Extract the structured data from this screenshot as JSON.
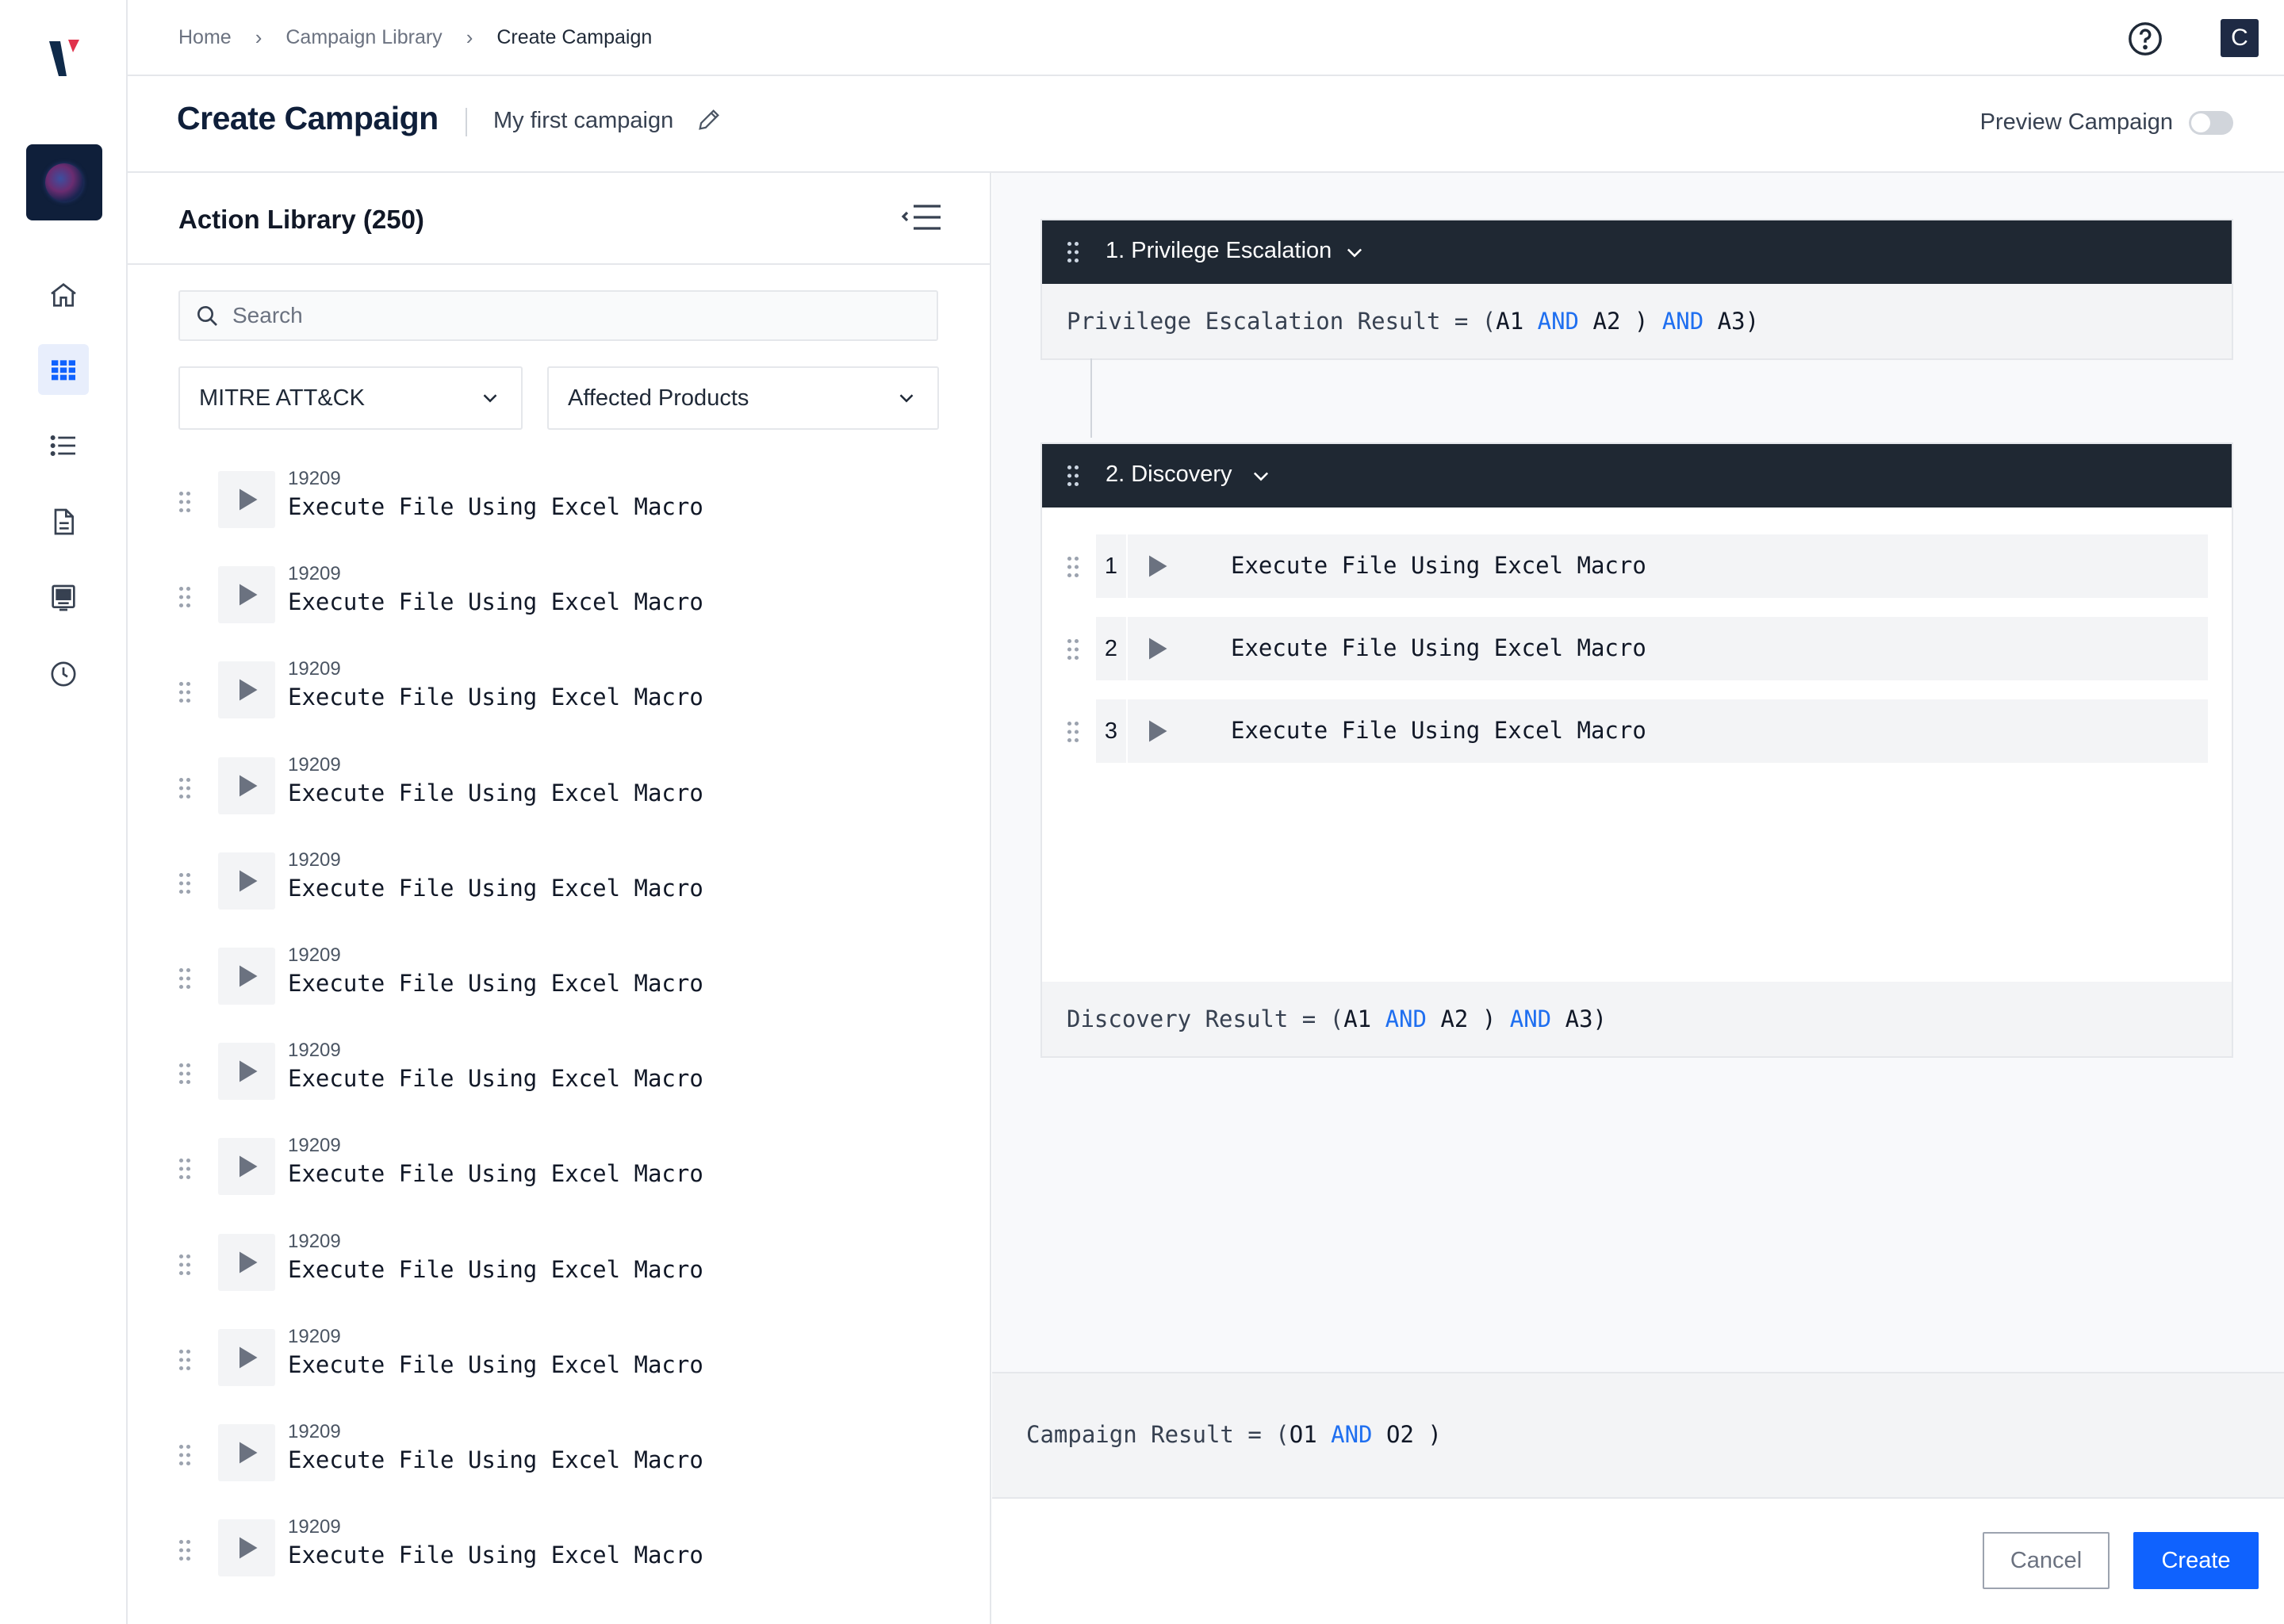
{
  "breadcrumb": [
    "Home",
    "Campaign Library",
    "Create Campaign"
  ],
  "avatar_initial": "C",
  "header": {
    "title": "Create Campaign",
    "campaign_name": "My first campaign",
    "preview_label": "Preview Campaign",
    "preview_enabled": false
  },
  "library": {
    "title": "Action Library (250)",
    "search_placeholder": "Search",
    "filters": [
      "MITRE ATT&CK",
      "Affected Products"
    ],
    "items": [
      {
        "id": "19209",
        "name": "Execute File Using Excel Macro"
      },
      {
        "id": "19209",
        "name": "Execute File Using Excel Macro"
      },
      {
        "id": "19209",
        "name": "Execute File Using Excel Macro"
      },
      {
        "id": "19209",
        "name": "Execute File Using Excel Macro"
      },
      {
        "id": "19209",
        "name": "Execute File Using Excel Macro"
      },
      {
        "id": "19209",
        "name": "Execute File Using Excel Macro"
      },
      {
        "id": "19209",
        "name": "Execute File Using Excel Macro"
      },
      {
        "id": "19209",
        "name": "Execute File Using Excel Macro"
      },
      {
        "id": "19209",
        "name": "Execute File Using Excel Macro"
      },
      {
        "id": "19209",
        "name": "Execute File Using Excel Macro"
      },
      {
        "id": "19209",
        "name": "Execute File Using Excel Macro"
      },
      {
        "id": "19209",
        "name": "Execute File Using Excel Macro"
      }
    ]
  },
  "stages": [
    {
      "title": "1. Privilege Escalation",
      "result_label": "Privilege Escalation Result = (",
      "result_tokens": [
        "A1",
        "AND",
        "A2 )",
        "AND",
        "A3)"
      ],
      "actions": []
    },
    {
      "title": "2. Discovery",
      "result_label": "Discovery Result = (",
      "result_tokens": [
        "A1",
        "AND",
        "A2 )",
        "AND",
        "A3)"
      ],
      "actions": [
        {
          "num": "1",
          "name": "Execute File Using Excel Macro"
        },
        {
          "num": "2",
          "name": "Execute File Using Excel Macro"
        },
        {
          "num": "3",
          "name": "Execute File Using Excel Macro"
        }
      ]
    }
  ],
  "campaign_result": {
    "label": "Campaign Result = (",
    "tokens": [
      "O1",
      "AND",
      "O2 )"
    ]
  },
  "footer": {
    "cancel": "Cancel",
    "create": "Create"
  },
  "colors": {
    "accent": "#0f62fe",
    "keyword": "#1f6ff0",
    "stage_header": "#1f2833",
    "brand_navy": "#0f1f3a",
    "brand_red": "#e0314b"
  },
  "icons": {
    "rail": [
      "home-icon",
      "grid-icon",
      "list-icon",
      "document-icon",
      "monitor-icon",
      "clock-icon"
    ]
  }
}
